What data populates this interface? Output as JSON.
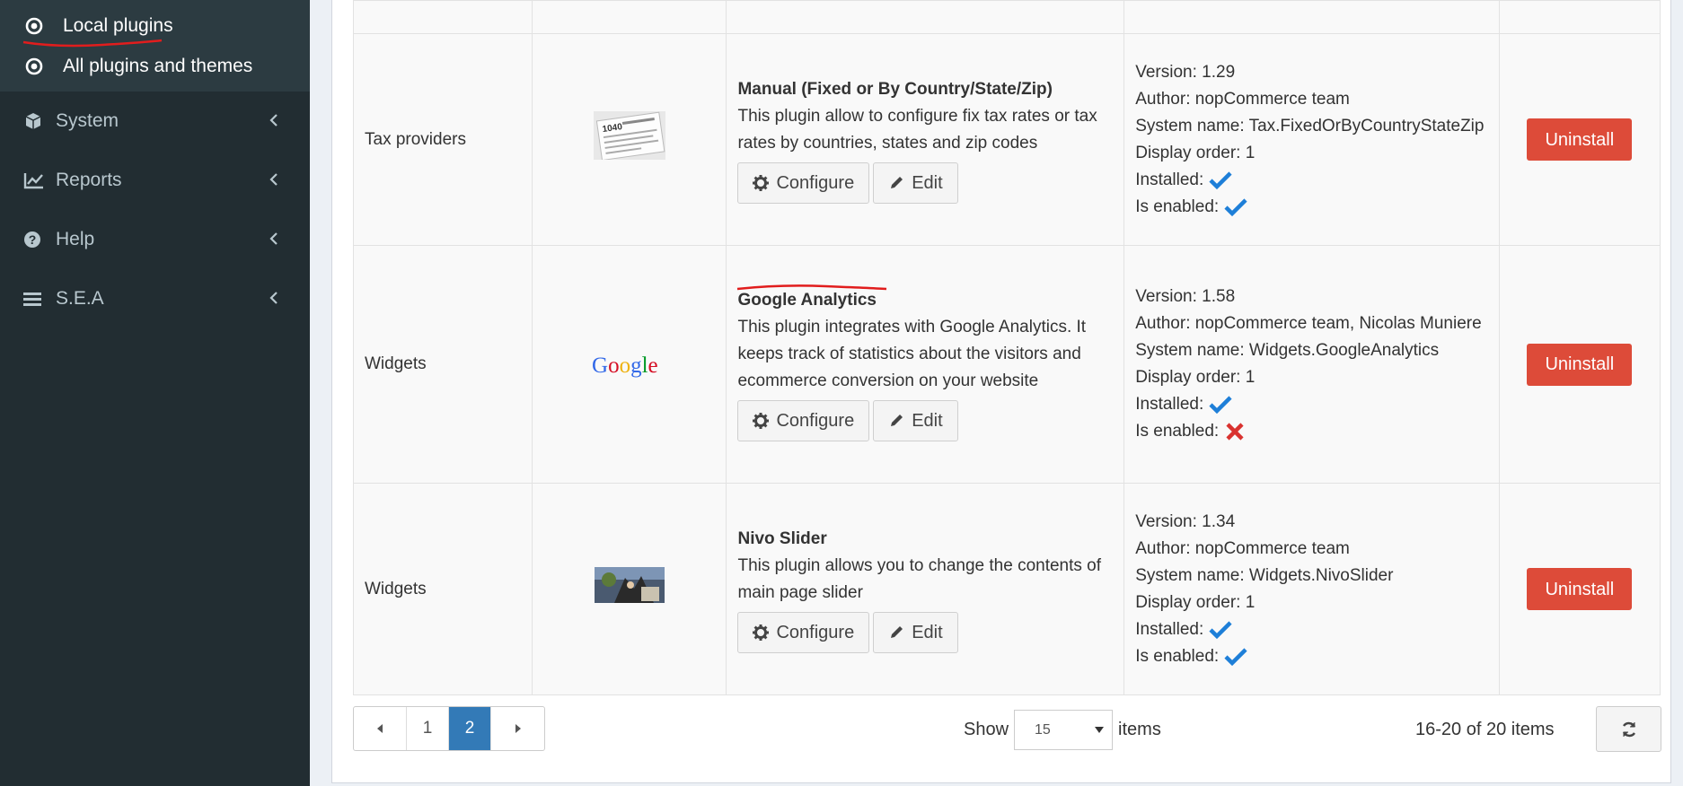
{
  "sidebar": {
    "sub_items": [
      {
        "label": "Local plugins"
      },
      {
        "label": "All plugins and themes"
      }
    ],
    "nav_items": [
      {
        "label": "System"
      },
      {
        "label": "Reports"
      },
      {
        "label": "Help"
      },
      {
        "label": "S.E.A"
      }
    ]
  },
  "table": {
    "rows": [
      {
        "group": "Tax providers",
        "name": "Manual (Fixed or By Country/State/Zip)",
        "description": "This plugin allow to configure fix tax rates or tax rates by countries, states and zip codes",
        "version": "Version: 1.29",
        "author": "Author: nopCommerce team",
        "system_name": "System name: Tax.FixedOrByCountryStateZip",
        "display_order": "Display order: 1",
        "installed_label": "Installed:",
        "enabled_label": "Is enabled:",
        "installed": true,
        "enabled": true,
        "logo_text": "1040"
      },
      {
        "group": "Widgets",
        "name": "Google Analytics",
        "description": "This plugin integrates with Google Analytics. It keeps track of statistics about the visitors and ecommerce conversion on your website",
        "version": "Version: 1.58",
        "author": "Author: nopCommerce team, Nicolas Muniere",
        "system_name": "System name: Widgets.GoogleAnalytics",
        "display_order": "Display order: 1",
        "installed_label": "Installed:",
        "enabled_label": "Is enabled:",
        "installed": true,
        "enabled": false,
        "logo_text": "Google"
      },
      {
        "group": "Widgets",
        "name": "Nivo Slider",
        "description": "This plugin allows you to change the contents of main page slider",
        "version": "Version: 1.34",
        "author": "Author: nopCommerce team",
        "system_name": "System name: Widgets.NivoSlider",
        "display_order": "Display order: 1",
        "installed_label": "Installed:",
        "enabled_label": "Is enabled:",
        "installed": true,
        "enabled": true,
        "logo_text": ""
      }
    ],
    "configure_label": "Configure",
    "edit_label": "Edit",
    "uninstall_label": "Uninstall"
  },
  "pager": {
    "pages": [
      "1",
      "2"
    ],
    "active_page": "2",
    "show_label": "Show",
    "page_size": "15",
    "items_label": "items",
    "count_text": "16-20 of 20 items"
  },
  "colors": {
    "sidebar_bg": "#222d32",
    "uninstall": "#dd4b39",
    "active_page": "#337ab7",
    "check": "#1e7fd8",
    "cross": "#d9322f",
    "annotation": "#e11d1d"
  }
}
